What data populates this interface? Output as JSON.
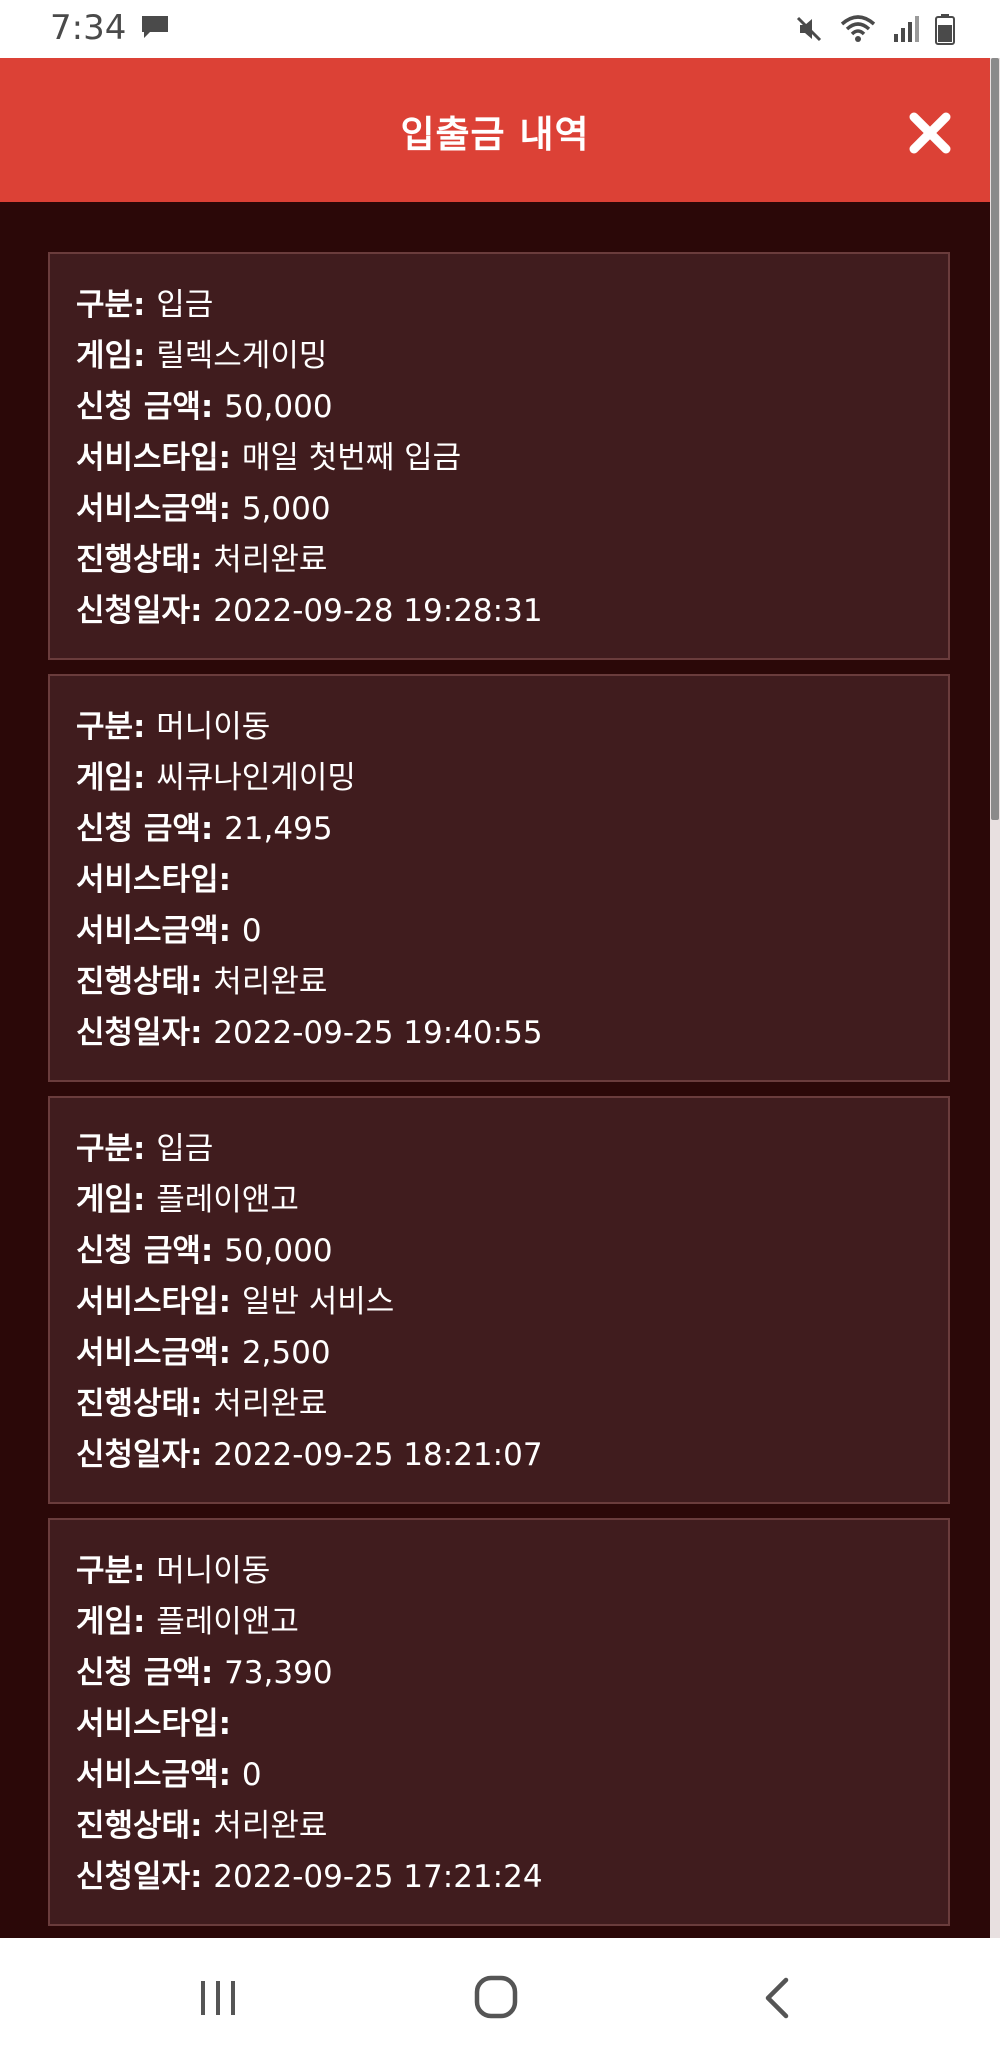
{
  "status_bar": {
    "time": "7:34",
    "left_icons": [
      "chat-bubble-icon"
    ],
    "right_icons": [
      "mute-icon",
      "wifi-icon",
      "signal-icon",
      "battery-icon"
    ]
  },
  "header": {
    "title": "입출금 내역",
    "close_icon": "close-icon",
    "background_color": "#dc4136"
  },
  "labels": {
    "category": "구분",
    "game": "게임",
    "amount": "신청 금액",
    "service_type": "서비스타입",
    "service_amount": "서비스금액",
    "status": "진행상태",
    "date": "신청일자"
  },
  "records": [
    {
      "category": "입금",
      "game": "릴렉스게이밍",
      "amount": "50,000",
      "service_type": "매일 첫번째 입금",
      "service_amount": "5,000",
      "status": "처리완료",
      "date": "2022-09-28 19:28:31"
    },
    {
      "category": "머니이동",
      "game": "씨큐나인게이밍",
      "amount": "21,495",
      "service_type": "",
      "service_amount": "0",
      "status": "처리완료",
      "date": "2022-09-25 19:40:55"
    },
    {
      "category": "입금",
      "game": "플레이앤고",
      "amount": "50,000",
      "service_type": "일반 서비스",
      "service_amount": "2,500",
      "status": "처리완료",
      "date": "2022-09-25 18:21:07"
    },
    {
      "category": "머니이동",
      "game": "플레이앤고",
      "amount": "73,390",
      "service_type": "",
      "service_amount": "0",
      "status": "처리완료",
      "date": "2022-09-25 17:21:24"
    }
  ],
  "nav_bar": {
    "icons": [
      "recent-apps-icon",
      "home-icon",
      "back-icon"
    ]
  }
}
